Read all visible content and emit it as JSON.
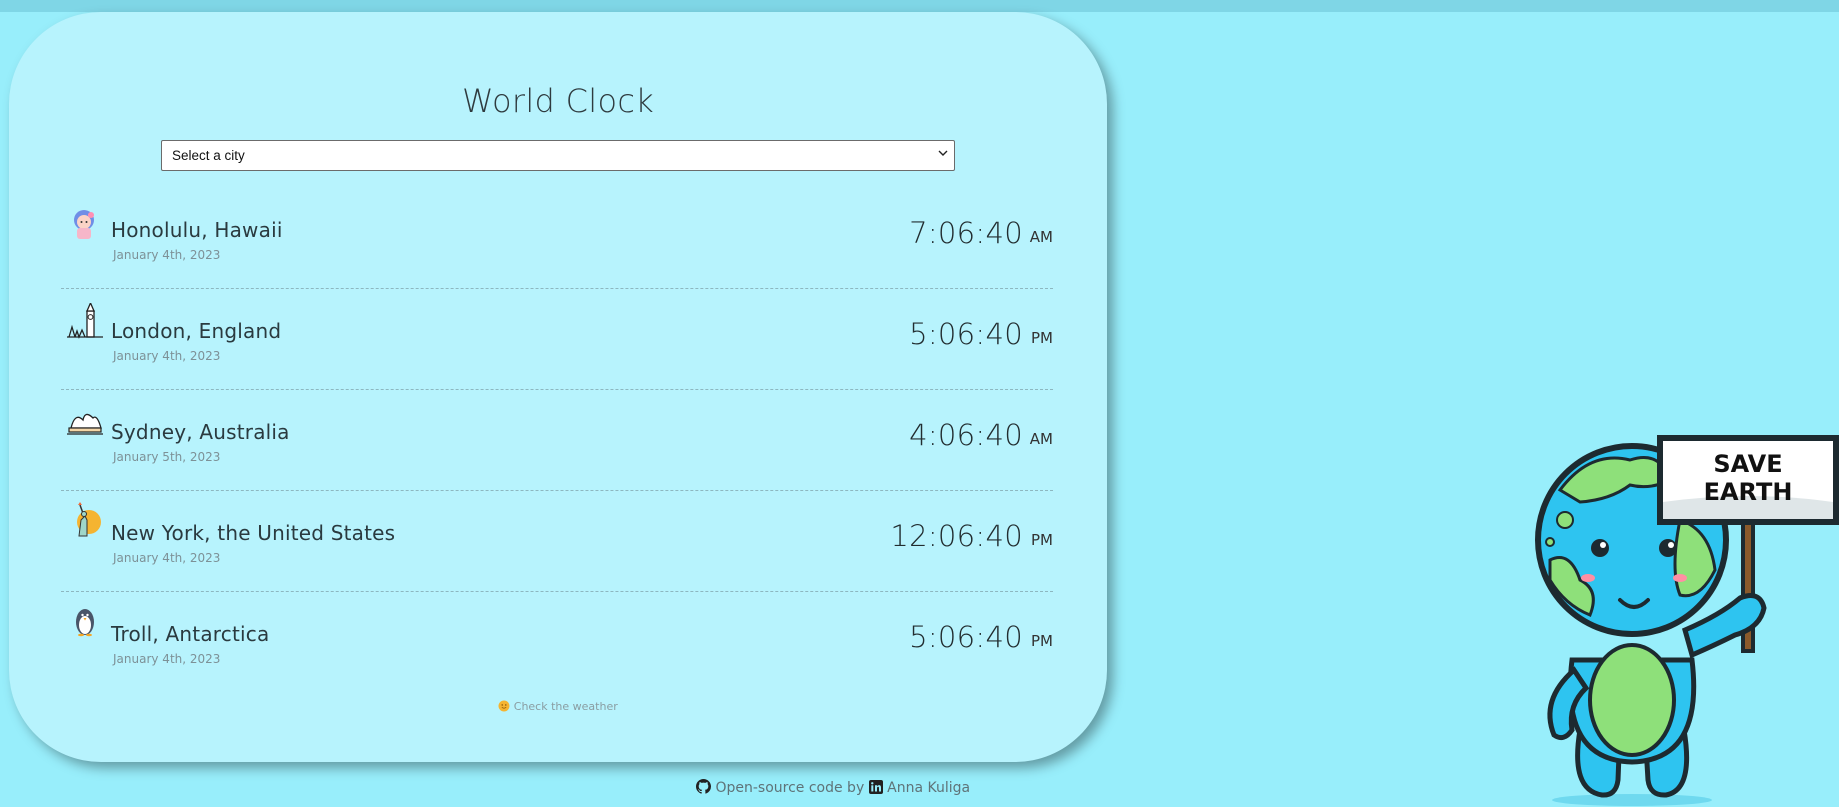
{
  "app": {
    "title": "World Clock"
  },
  "select": {
    "placeholder": "Select a city"
  },
  "cities": [
    {
      "name": "Honolulu, Hawaii",
      "date": "January 4th, 2023",
      "time": "7:06:40",
      "ampm": "AM",
      "icon": "hula-girl-icon"
    },
    {
      "name": "London, England",
      "date": "January 4th, 2023",
      "time": "5:06:40",
      "ampm": "PM",
      "icon": "big-ben-icon"
    },
    {
      "name": "Sydney, Australia",
      "date": "January 5th, 2023",
      "time": "4:06:40",
      "ampm": "AM",
      "icon": "opera-house-icon"
    },
    {
      "name": "New York, the United States",
      "date": "January 4th, 2023",
      "time": "12:06:40",
      "ampm": "PM",
      "icon": "statue-of-liberty-icon"
    },
    {
      "name": "Troll, Antarctica",
      "date": "January 4th, 2023",
      "time": "5:06:40",
      "ampm": "PM",
      "icon": "penguin-icon"
    }
  ],
  "weather_link": {
    "text": "Check the weather",
    "icon": "sun-face-icon"
  },
  "footer": {
    "code_link": "Open-source code",
    "by": " by ",
    "author_link": "Anna Kuliga"
  },
  "mascot": {
    "sign_line1": "SAVE",
    "sign_line2": "EARTH"
  },
  "colors": {
    "background": "#98eefb",
    "card": "#b7f3fd",
    "earth_blue": "#2ec4f0",
    "earth_green": "#8ee07a"
  }
}
